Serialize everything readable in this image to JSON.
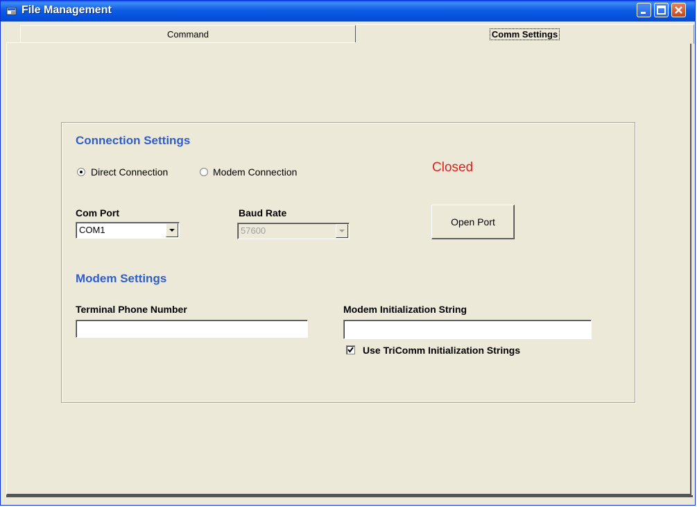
{
  "window": {
    "title": "File Management"
  },
  "tabs": {
    "command": "Command",
    "comm_settings": "Comm Settings"
  },
  "connection": {
    "title": "Connection Settings",
    "direct_label": "Direct Connection",
    "modem_label": "Modem Connection",
    "selected": "direct",
    "status": "Closed",
    "status_color": "#e02020",
    "com_port_label": "Com Port",
    "com_port_value": "COM1",
    "baud_rate_label": "Baud Rate",
    "baud_rate_value": "57600",
    "open_port_label": "Open Port"
  },
  "modem": {
    "title": "Modem Settings",
    "phone_label": "Terminal Phone Number",
    "phone_value": "",
    "init_label": "Modem Initialization String",
    "init_value": "",
    "use_tricomm_label": "Use TriComm Initialization Strings",
    "use_tricomm_checked": true
  },
  "colors": {
    "section_title": "#2f5ec8",
    "titlebar": "#0550dc"
  }
}
